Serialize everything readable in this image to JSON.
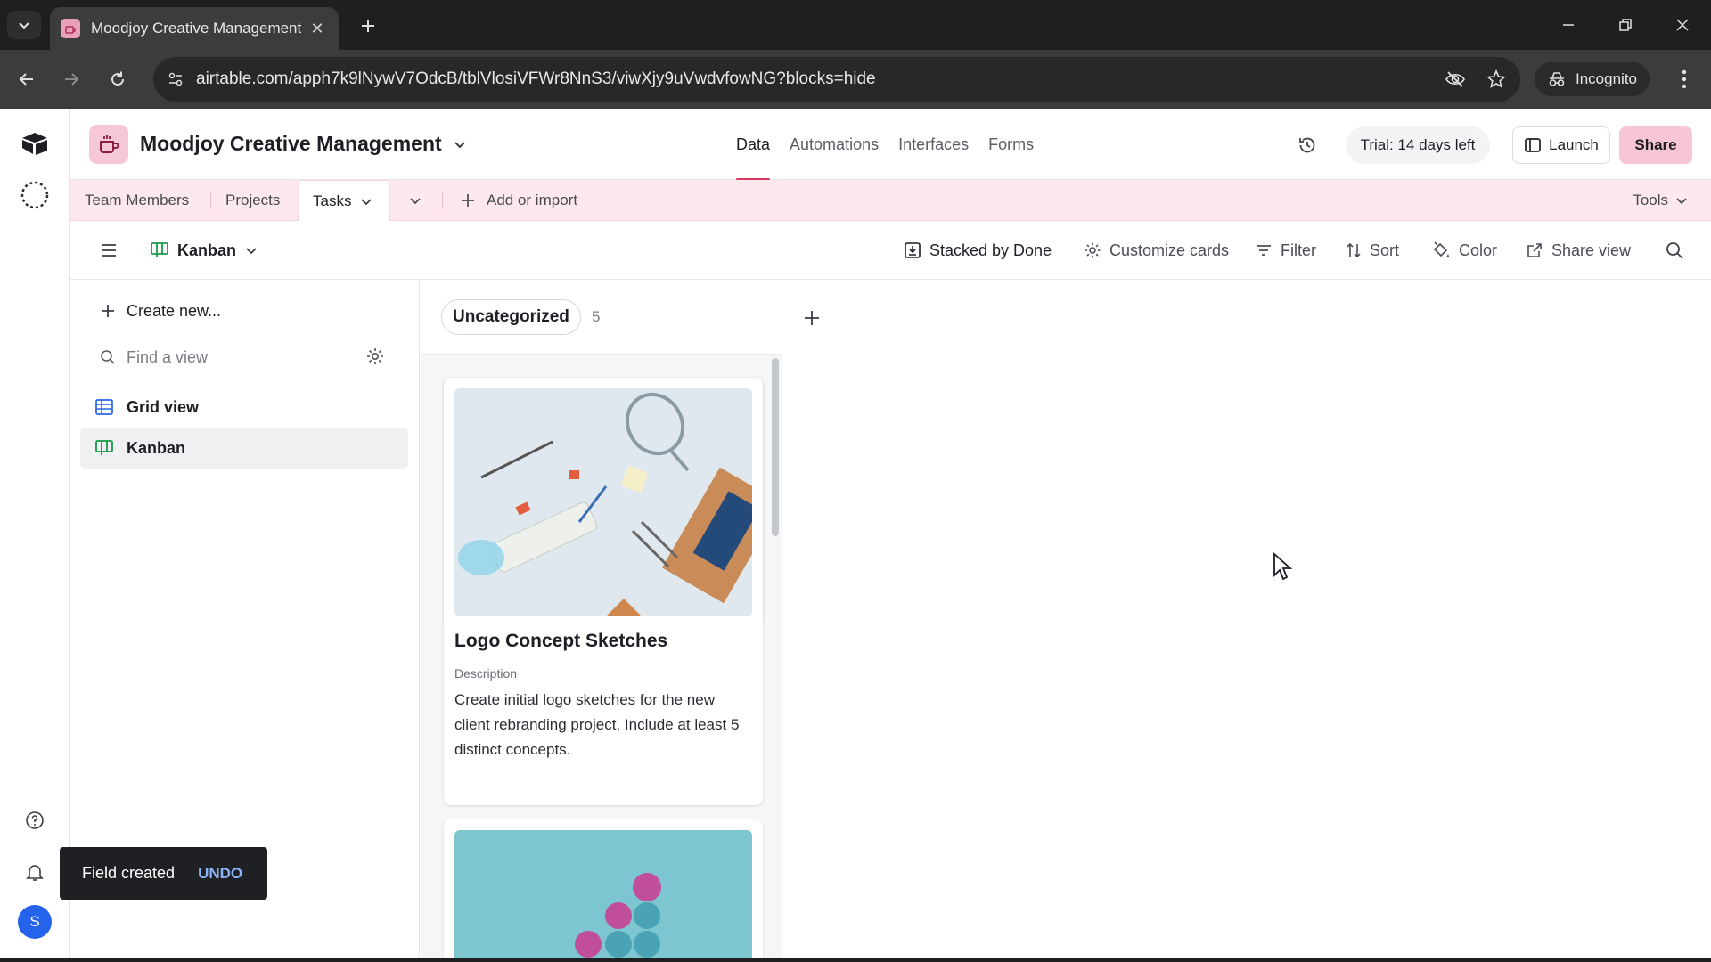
{
  "browser": {
    "tab_title": "Moodjoy Creative Management",
    "url": "airtable.com/apph7k9lNywV7OdcB/tblVlosiVFWr8NnS3/viwXjy9uVwdvfowNG?blocks=hide",
    "incognito_label": "Incognito"
  },
  "base": {
    "name": "Moodjoy Creative Management",
    "nav_tabs": [
      "Data",
      "Automations",
      "Interfaces",
      "Forms"
    ],
    "active_nav": "Data",
    "trial_label": "Trial: 14 days left",
    "launch_label": "Launch",
    "share_label": "Share"
  },
  "tables": {
    "items": [
      "Team Members",
      "Projects",
      "Tasks"
    ],
    "active": "Tasks",
    "add_label": "Add or import",
    "tools_label": "Tools"
  },
  "viewbar": {
    "current_view": "Kanban",
    "stacked_by": "Stacked by Done",
    "customize": "Customize cards",
    "filter": "Filter",
    "sort": "Sort",
    "color": "Color",
    "share_view": "Share view"
  },
  "sidebar": {
    "create_new": "Create new...",
    "find_placeholder": "Find a view",
    "views": [
      {
        "label": "Grid view",
        "selected": false
      },
      {
        "label": "Kanban",
        "selected": true
      }
    ]
  },
  "kanban": {
    "stack_name": "Uncategorized",
    "stack_count": "5",
    "cards": [
      {
        "title": "Logo Concept Sketches",
        "field_label": "Description",
        "field_value": "Create initial logo sketches for the new client rebranding project. Include at least 5 distinct concepts."
      }
    ]
  },
  "toast": {
    "message": "Field created",
    "action": "UNDO"
  },
  "rail": {
    "avatar_initial": "S"
  },
  "colors": {
    "accent": "#d33a62",
    "table_bar": "#fde8ef",
    "share_button": "#f7c6d4"
  }
}
